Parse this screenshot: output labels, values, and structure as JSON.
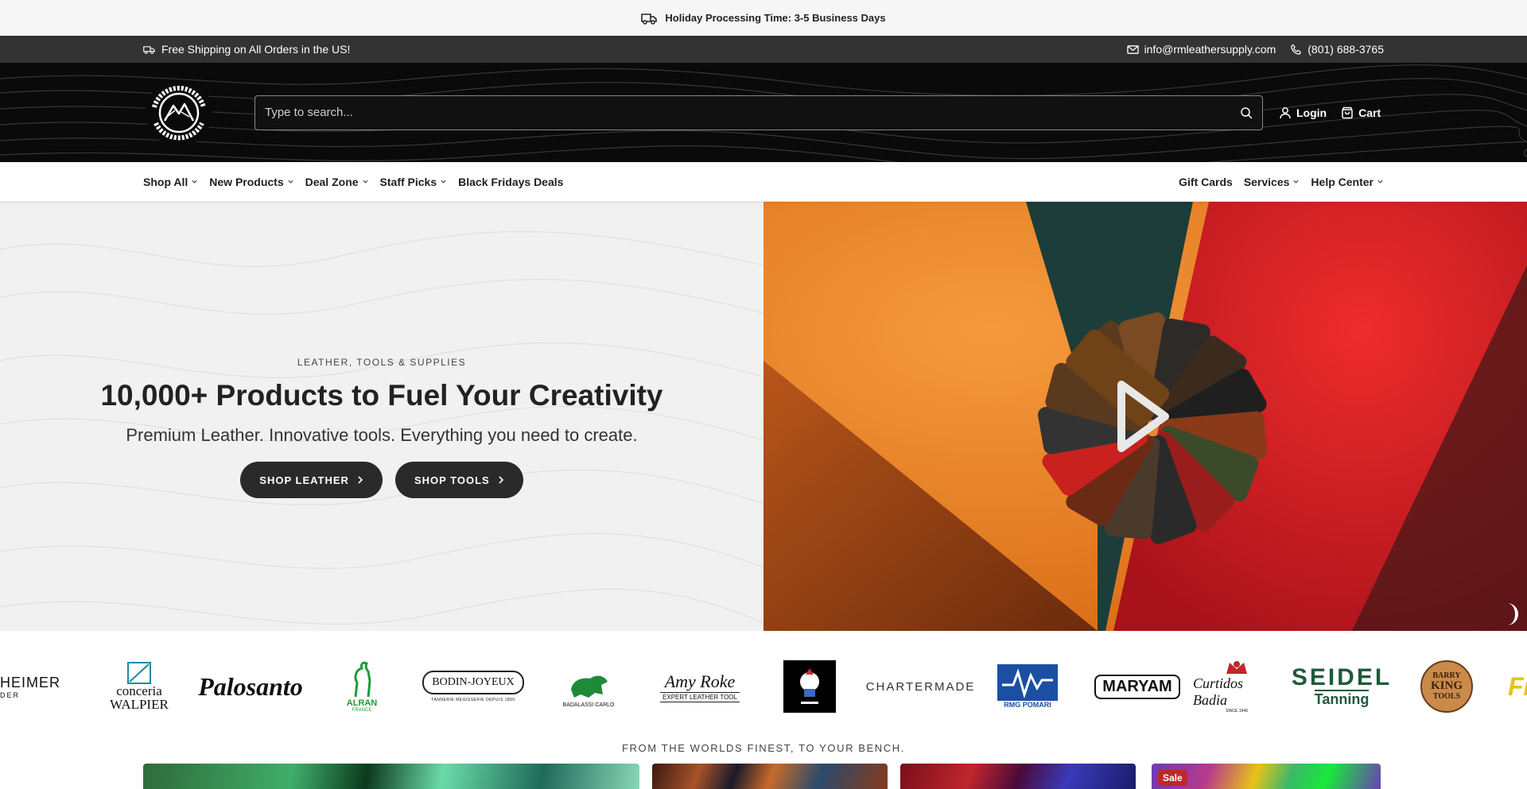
{
  "announcement": {
    "text": "Holiday Processing Time: 3-5 Business Days"
  },
  "utility": {
    "shipping": "Free Shipping on All Orders in the US!",
    "email": "info@rmleathersupply.com",
    "phone": "(801) 688-3765"
  },
  "header": {
    "search_placeholder": "Type to search...",
    "login": "Login",
    "cart": "Cart"
  },
  "nav": {
    "left": [
      "Shop All",
      "New Products",
      "Deal Zone",
      "Staff Picks",
      "Black Fridays Deals"
    ],
    "right": [
      "Gift Cards",
      "Services",
      "Help Center"
    ]
  },
  "hero": {
    "eyebrow": "LEATHER, TOOLS & SUPPLIES",
    "title": "10,000+ Products to Fuel Your Creativity",
    "subtitle": "Premium Leather. Innovative tools. Everything you need to create.",
    "btn1": "SHOP LEATHER",
    "btn2": "SHOP TOOLS"
  },
  "brands": {
    "partial_left": "HEIMER",
    "partial_left_sub": "DER",
    "walpier_1": "conceria",
    "walpier_2": "WALPIER",
    "palosanto": "Palosanto",
    "alran": "ALRAN",
    "alran_sub": "FRANCE",
    "bodin": "BODIN-JOYEUX",
    "bodin_sub": "TANNERIE MEGISSERIE DEPUIS 1860",
    "badalassi": "BADALASSI CARLO",
    "amyroke_1": "Amy Roke",
    "amyroke_2": "EXPERT LEATHER TOOL",
    "chartermade": "CHARTERMADE",
    "rmg": "RMG POMARI",
    "maryam": "MARYAM",
    "curtidos": "Curtidos Badia",
    "curtidos_sub": "SINCE 1949",
    "seidel_1": "SEIDEL",
    "seidel_2": "Tanning",
    "barry_1": "BARRY",
    "barry_2": "KING",
    "barry_3": "TOOLS",
    "partial_right": "Fie"
  },
  "tagline": "FROM THE WORLDS FINEST, TO YOUR BENCH.",
  "tiles": {
    "sale_badge": "Sale"
  },
  "colors": {
    "dark": "#2a2a2a",
    "header_bg": "#0a0a0a",
    "utility_bg": "#333333",
    "sale": "#c0262d"
  }
}
